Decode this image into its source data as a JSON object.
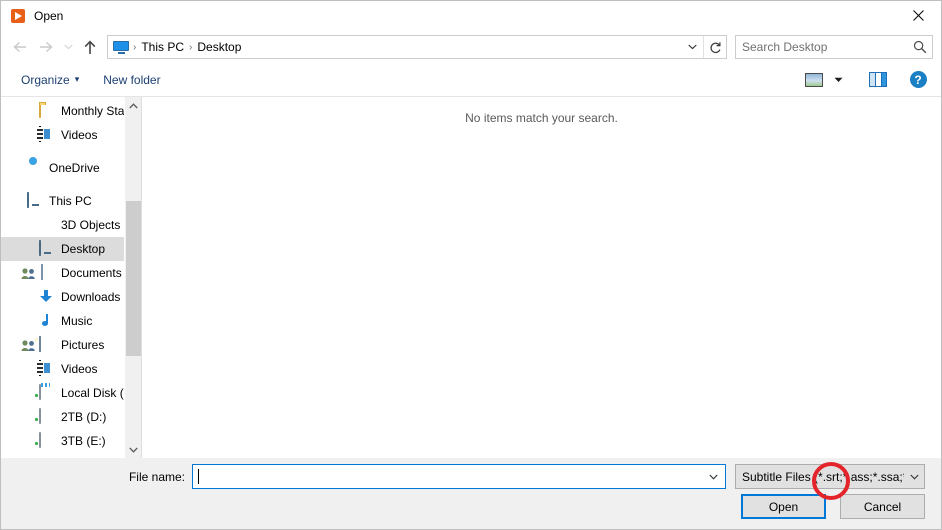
{
  "window": {
    "title": "Open",
    "app_icon": "vlc-cone-icon",
    "close_label": "✕",
    "accent_color": "#0078d7",
    "annotation_color": "#e3242b"
  },
  "navbar": {
    "back_icon": "arrow-left-icon",
    "forward_icon": "arrow-right-icon",
    "recent_icon": "chevron-down-icon",
    "up_icon": "arrow-up-icon",
    "breadcrumb_icon": "monitor-icon",
    "breadcrumb": [
      "This PC",
      "Desktop"
    ],
    "separator": "›",
    "address_dropdown_icon": "chevron-down-icon",
    "refresh_icon": "refresh-icon",
    "search": {
      "placeholder": "Search Desktop",
      "value": "",
      "icon": "search-icon"
    }
  },
  "toolbar": {
    "organize_label": "Organize",
    "organize_caret": "▾",
    "new_folder_label": "New folder",
    "view_icon": "view-thumbnails-icon",
    "view_caret_icon": "chevron-down-icon",
    "preview_pane_icon": "preview-pane-icon",
    "help_icon": "help-icon",
    "help_label": "?"
  },
  "sidebar": {
    "items": [
      {
        "label": "Monthly Statem",
        "icon": "folder-icon",
        "indent": 2,
        "selected": false,
        "shared": false
      },
      {
        "label": "Videos",
        "icon": "video-folder-icon",
        "indent": 2,
        "selected": false,
        "shared": false
      },
      {
        "label": "OneDrive",
        "icon": "onedrive-cloud-icon",
        "indent": 1,
        "selected": false,
        "shared": false,
        "group_start": true
      },
      {
        "label": "This PC",
        "icon": "monitor-icon",
        "indent": 1,
        "selected": false,
        "shared": false,
        "group_start": true
      },
      {
        "label": "3D Objects",
        "icon": "3d-objects-cube-icon",
        "indent": 2,
        "selected": false,
        "shared": false
      },
      {
        "label": "Desktop",
        "icon": "desktop-monitor-icon",
        "indent": 2,
        "selected": true,
        "shared": false
      },
      {
        "label": "Documents",
        "icon": "documents-icon",
        "indent": 2,
        "selected": false,
        "shared": true
      },
      {
        "label": "Downloads",
        "icon": "downloads-arrow-icon",
        "indent": 2,
        "selected": false,
        "shared": false
      },
      {
        "label": "Music",
        "icon": "music-note-icon",
        "indent": 2,
        "selected": false,
        "shared": false
      },
      {
        "label": "Pictures",
        "icon": "pictures-icon",
        "indent": 2,
        "selected": false,
        "shared": true
      },
      {
        "label": "Videos",
        "icon": "video-folder-icon",
        "indent": 2,
        "selected": false,
        "shared": false
      },
      {
        "label": "Local Disk (C:)",
        "icon": "system-disk-icon",
        "indent": 2,
        "selected": false,
        "shared": false
      },
      {
        "label": "2TB (D:)",
        "icon": "disk-icon",
        "indent": 2,
        "selected": false,
        "shared": false
      },
      {
        "label": "3TB (E:)",
        "icon": "disk-icon",
        "indent": 2,
        "selected": false,
        "shared": false
      }
    ],
    "scrollbar": {
      "up_icon": "chevron-up-icon",
      "down_icon": "chevron-down-icon"
    }
  },
  "filelist": {
    "empty_message": "No items match your search."
  },
  "footer": {
    "filename_label": "File name:",
    "filename_value": "",
    "filename_dropdown_icon": "chevron-down-icon",
    "filetype_value": "Subtitle Files (*.srt;*.ass;*.ssa;*.i",
    "filetype_dropdown_icon": "chevron-down-icon",
    "open_label": "Open",
    "cancel_label": "Cancel"
  },
  "annotation": {
    "shape": "circle",
    "target_text": ".srt;",
    "color": "#e3242b"
  }
}
